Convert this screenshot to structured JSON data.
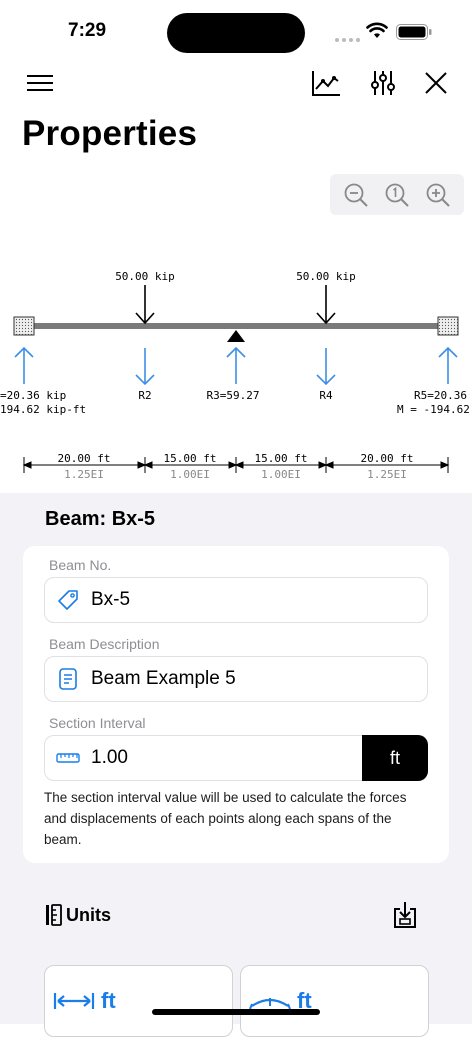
{
  "status": {
    "time": "7:29"
  },
  "header": {
    "title": "Properties"
  },
  "diagram": {
    "loads": [
      "50.00 kip",
      "50.00 kip"
    ],
    "reactions": {
      "r1_line1": "=20.36 kip",
      "r1_line2": "194.62 kip-ft",
      "r2": "R2",
      "r3": "R3=59.27",
      "r4": "R4",
      "r5_line1": "R5=20.36 k",
      "r5_line2": "M = -194.62 k"
    },
    "spans": [
      {
        "length": "20.00 ft",
        "stiffness": "1.25EI"
      },
      {
        "length": "15.00 ft",
        "stiffness": "1.00EI"
      },
      {
        "length": "15.00 ft",
        "stiffness": "1.00EI"
      },
      {
        "length": "20.00 ft",
        "stiffness": "1.25EI"
      }
    ]
  },
  "beam": {
    "heading": "Beam: Bx-5",
    "beam_no_label": "Beam No.",
    "beam_no_value": "Bx-5",
    "desc_label": "Beam Description",
    "desc_value": "Beam Example 5",
    "interval_label": "Section Interval",
    "interval_value": "1.00",
    "interval_unit": "ft",
    "note": "The section interval value will be used to calculate the forces and displacements of each points along each spans of the beam."
  },
  "units": {
    "title": "Units",
    "length_unit": "ft",
    "deflection_unit": "ft"
  },
  "icons": {
    "menu": "hamburger-icon",
    "chart": "chart-icon",
    "settings": "sliders-icon",
    "close": "close-icon",
    "zoom_out": "zoom-out-icon",
    "zoom_reset": "zoom-reset-icon",
    "zoom_in": "zoom-in-icon",
    "tag": "tag-icon",
    "document": "document-icon",
    "ruler": "ruler-icon",
    "units": "units-icon",
    "import": "import-icon"
  },
  "colors": {
    "accent": "#1a7de8",
    "reaction": "#3d8fe6"
  }
}
